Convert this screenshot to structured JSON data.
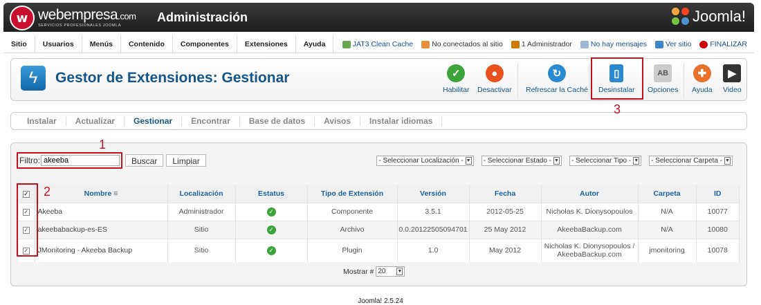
{
  "header": {
    "brand": "webempresa",
    "brand_suffix": ".com",
    "brand_tagline": "SERVICIOS PROFESIONALES JOOMLA",
    "title": "Administración",
    "joomla_logo_text": "Joomla!"
  },
  "menu": [
    "Sitio",
    "Usuarios",
    "Menús",
    "Contenido",
    "Componentes",
    "Extensiones",
    "Ayuda"
  ],
  "status": {
    "cache": "JAT3 Clean Cache",
    "connected": "No conectados al sitio",
    "admins": "1 Administrador",
    "messages": "No hay mensajes",
    "view_site": "Ver sitio",
    "logout": "FINALIZAR"
  },
  "toolbar": {
    "title": "Gestor de Extensiones: Gestionar",
    "enable": "Habilitar",
    "disable": "Desactivar",
    "refresh_cache": "Refrescar la Caché",
    "uninstall": "Desinstalar",
    "options": "Opciones",
    "help": "Ayuda",
    "video": "Video"
  },
  "subnav": [
    "Instalar",
    "Actualizar",
    "Gestionar",
    "Encontrar",
    "Base de datos",
    "Avisos",
    "Instalar idiomas"
  ],
  "filter": {
    "label": "Filtro:",
    "value": "akeeba",
    "search_button": "Buscar",
    "clear_button": "Limpiar",
    "location_select": "- Seleccionar Localización -",
    "state_select": "- Seleccionar Estado -",
    "type_select": "- Seleccionar Tipo -",
    "folder_select": "- Seleccionar Carpeta -"
  },
  "table": {
    "columns": [
      "Nombre",
      "Localización",
      "Estatus",
      "Tipo de Extensión",
      "Versión",
      "Fecha",
      "Autor",
      "Carpeta",
      "ID"
    ],
    "rows": [
      {
        "name": "Akeeba",
        "location": "Administrador",
        "type": "Componente",
        "version": "3.5.1",
        "date": "2012-05-25",
        "author": "Nicholas K. Dionysopoulos",
        "folder": "N/A",
        "id": "10077"
      },
      {
        "name": "akeebabackup-es-ES",
        "location": "Sitio",
        "type": "Archivo",
        "version": "0.0.20122505094701",
        "date": "25 May 2012",
        "author": "AkeebaBackup.com",
        "folder": "N/A",
        "id": "10080"
      },
      {
        "name": "JMonitoring - Akeeba Backup",
        "location": "Sitio",
        "type": "Plugin",
        "version": "1.0",
        "date": "May 2012",
        "author_line1": "Nicholas K. Dionysopoulos /",
        "author_line2": "AkeebaBackup.com",
        "folder": "jmonitoring",
        "id": "10078"
      }
    ]
  },
  "pager": {
    "label": "Mostrar #",
    "value": "20"
  },
  "footer": "Joomla! 2.5.24",
  "annotations": [
    "1",
    "2",
    "3"
  ],
  "colors": {
    "accent": "#14568a",
    "annotation": "#c0121e",
    "enable": "#3da33d",
    "disable": "#e8521f",
    "refresh": "#2a8ad0",
    "uninstall": "#2a8ad0"
  }
}
